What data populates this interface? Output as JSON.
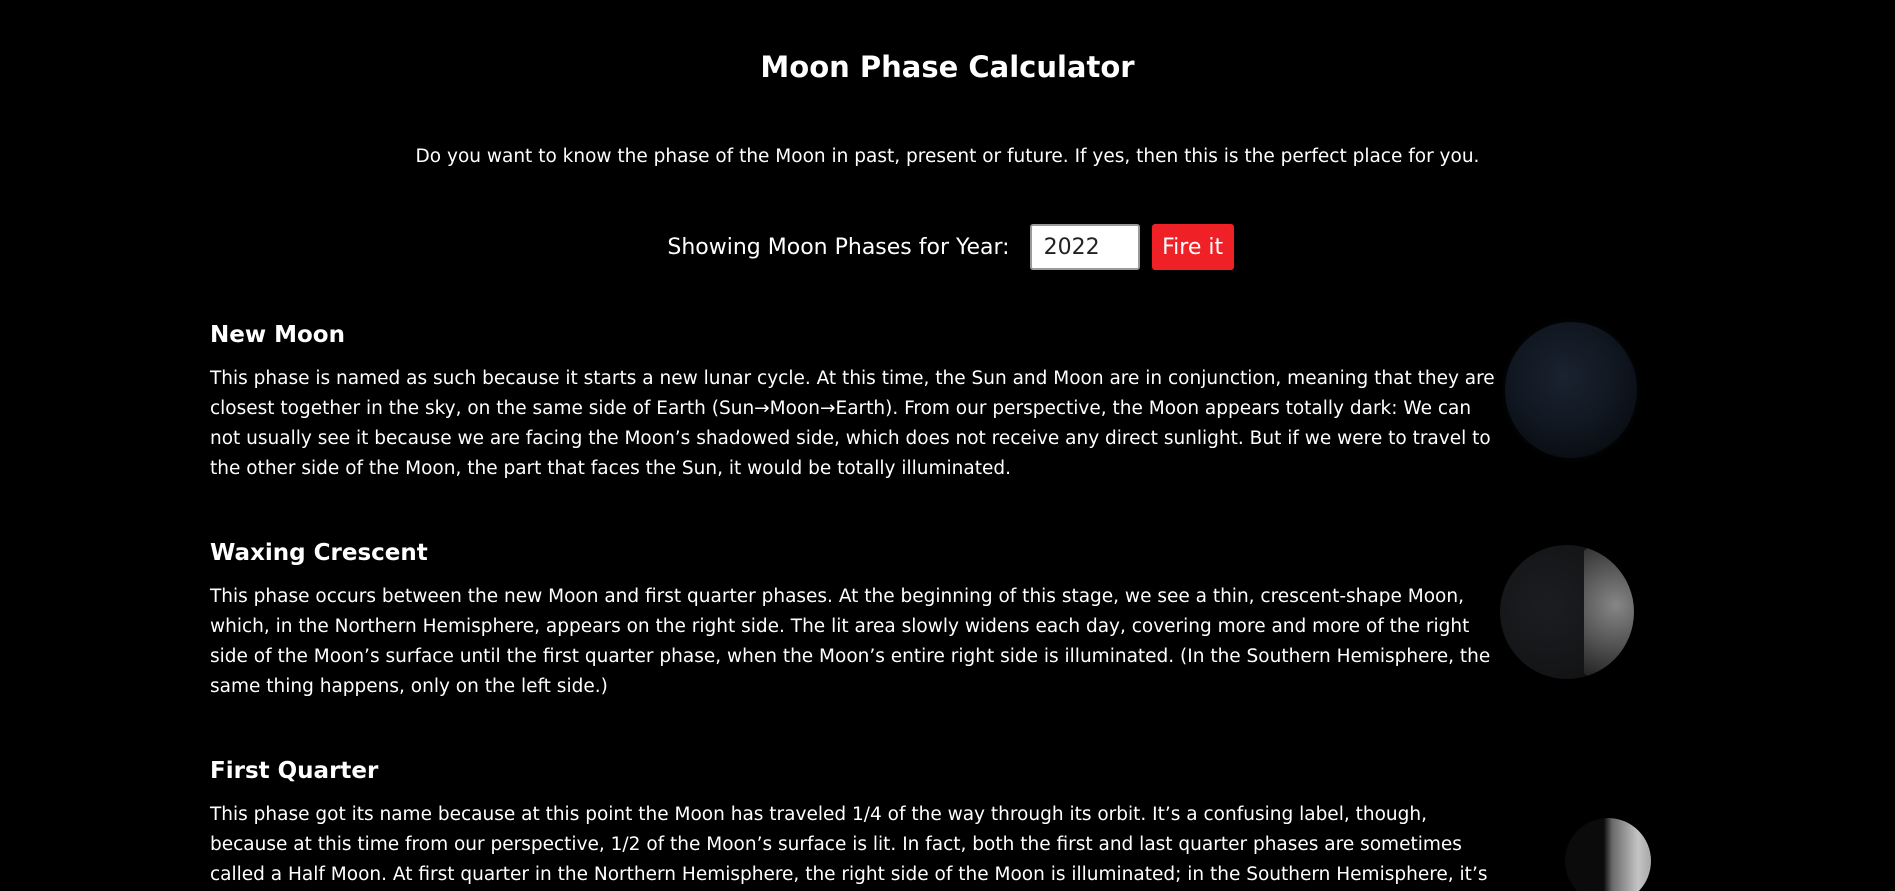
{
  "header": {
    "title": "Moon Phase Calculator",
    "intro": "Do you want to know the phase of the Moon in past, present or future. If yes, then this is the perfect place for you."
  },
  "year_form": {
    "label": "Showing Moon Phases for Year:",
    "year_value": "2022",
    "button_label": "Fire it"
  },
  "phases": [
    {
      "title": "New Moon",
      "description": "This phase is named as such because it starts a new lunar cycle. At this time, the Sun and Moon are in conjunction, meaning that they are closest together in the sky, on the same side of Earth (Sun→Moon→Earth). From our perspective, the Moon appears totally dark: We can not usually see it because we are facing the Moon’s shadowed side, which does not receive any direct sunlight. But if we were to travel to the other side of the Moon, the part that faces the Sun, it would be totally illuminated."
    },
    {
      "title": "Waxing Crescent",
      "description": "This phase occurs between the new Moon and first quarter phases. At the beginning of this stage, we see a thin, crescent-shape Moon, which, in the Northern Hemisphere, appears on the right side. The lit area slowly widens each day, covering more and more of the right side of the Moon’s surface until the first quarter phase, when the Moon’s entire right side is illuminated. (In the Southern Hemisphere, the same thing happens, only on the left side.)"
    },
    {
      "title": "First Quarter",
      "description": "This phase got its name because at this point the Moon has traveled 1/4 of the way through its orbit. It’s a confusing label, though, because at this time from our perspective, 1/2 of the Moon’s surface is lit. In fact, both the first and last quarter phases are sometimes called a Half Moon. At first quarter in the Northern Hemisphere, the right side of the Moon is illuminated; in the Southern Hemisphere, it’s the left side. In actuality, we are"
    }
  ],
  "colors": {
    "background": "#000000",
    "text": "#ffffff",
    "button": "#f02027"
  }
}
